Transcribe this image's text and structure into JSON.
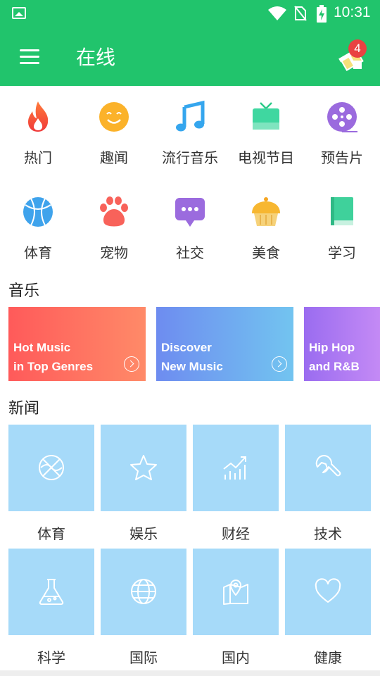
{
  "status_bar": {
    "time": "10:31"
  },
  "app_bar": {
    "title": "在线",
    "badge_count": "4"
  },
  "categories": [
    {
      "label": "热门",
      "icon": "fire-icon"
    },
    {
      "label": "趣闻",
      "icon": "smiley-icon"
    },
    {
      "label": "流行音乐",
      "icon": "music-note-icon"
    },
    {
      "label": "电视节目",
      "icon": "tv-icon"
    },
    {
      "label": "预告片",
      "icon": "film-reel-icon"
    },
    {
      "label": "体育",
      "icon": "basketball-icon"
    },
    {
      "label": "宠物",
      "icon": "paw-icon"
    },
    {
      "label": "社交",
      "icon": "chat-bubble-icon"
    },
    {
      "label": "美食",
      "icon": "cake-icon"
    },
    {
      "label": "学习",
      "icon": "book-icon"
    }
  ],
  "music": {
    "title": "音乐",
    "cards": [
      {
        "line1": "Hot Music",
        "line2": "in Top Genres"
      },
      {
        "line1": "Discover",
        "line2": "New Music"
      },
      {
        "line1": "Hip Hop",
        "line2": "and R&B"
      }
    ]
  },
  "news": {
    "title": "新闻",
    "items": [
      {
        "label": "体育",
        "icon": "ball-icon"
      },
      {
        "label": "娱乐",
        "icon": "star-icon"
      },
      {
        "label": "财经",
        "icon": "chart-icon"
      },
      {
        "label": "技术",
        "icon": "wrench-icon"
      },
      {
        "label": "科学",
        "icon": "flask-icon"
      },
      {
        "label": "国际",
        "icon": "globe-icon"
      },
      {
        "label": "国内",
        "icon": "map-pin-icon"
      },
      {
        "label": "健康",
        "icon": "heart-icon"
      }
    ]
  },
  "colors": {
    "primary": "#21c46c",
    "badge": "#e94242",
    "news_tile": "#a6daf9",
    "card_hot": "#ff5a5a",
    "card_discover": "#6f8ff0",
    "card_hiphop": "#9a6cf0"
  }
}
